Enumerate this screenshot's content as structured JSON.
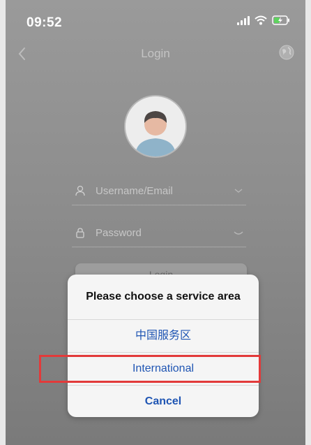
{
  "status_bar": {
    "time": "09:52"
  },
  "nav": {
    "title": "Login",
    "back_icon": "chevron-left-icon",
    "right_icon": "globe-icon"
  },
  "form": {
    "username_placeholder": "Username/Email",
    "password_placeholder": "Password",
    "login_label": "Login"
  },
  "dialog": {
    "title": "Please choose a service area",
    "options": [
      {
        "label": "中国服务区"
      },
      {
        "label": "International"
      }
    ],
    "cancel_label": "Cancel"
  },
  "colors": {
    "accent": "#1f55b3",
    "highlight": "#e23a3a"
  }
}
